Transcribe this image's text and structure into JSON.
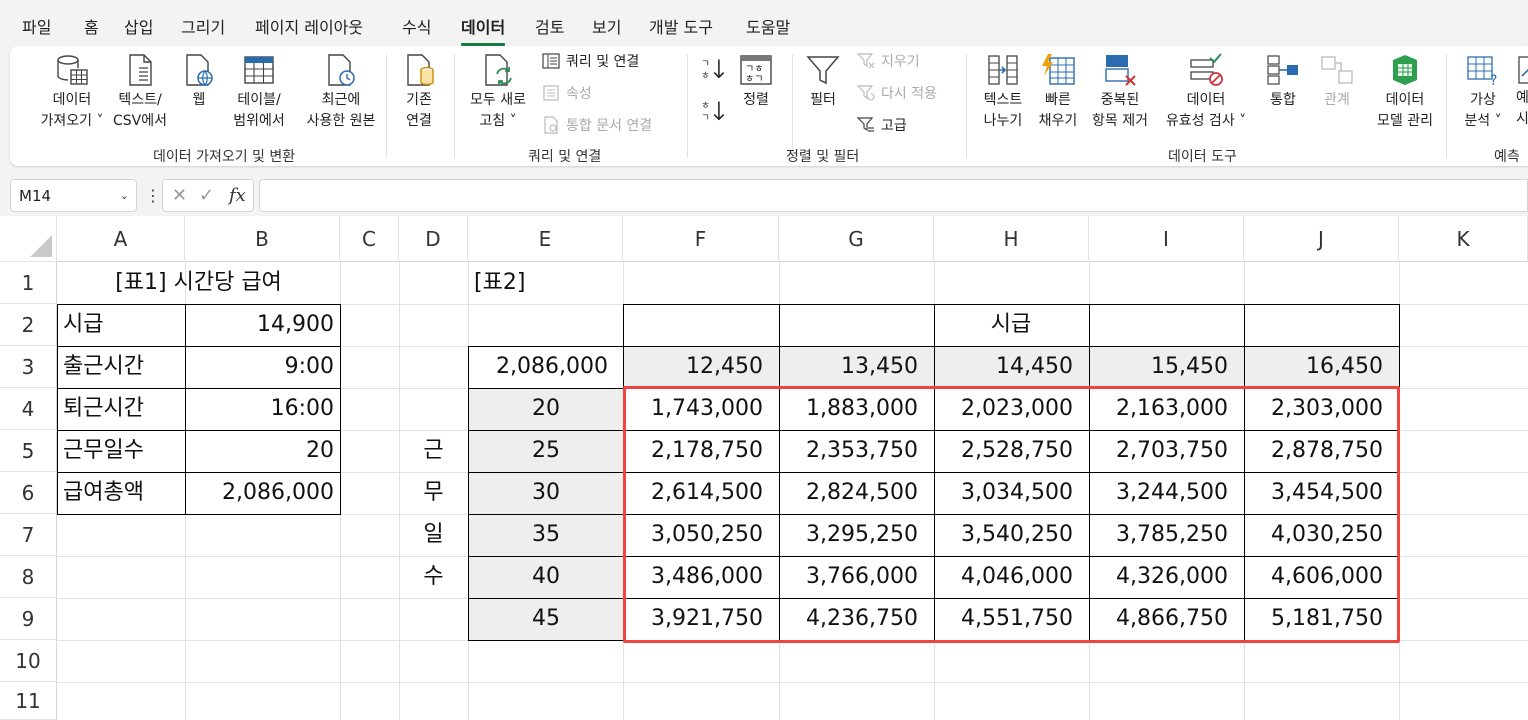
{
  "menu": [
    "파일",
    "홈",
    "삽입",
    "그리기",
    "페이지 레이아웃",
    "수식",
    "데이터",
    "검토",
    "보기",
    "개발 도구",
    "도움말"
  ],
  "active_menu": "데이터",
  "ribbon": {
    "get_data": {
      "l1": "데이터",
      "l2": "가져오기 ˅"
    },
    "text_csv": {
      "l1": "텍스트/",
      "l2": "CSV에서"
    },
    "web": {
      "l1": "웹"
    },
    "table_range": {
      "l1": "테이블/",
      "l2": "범위에서"
    },
    "recent_sources": {
      "l1": "최근에",
      "l2": "사용한 원본"
    },
    "existing_conn": {
      "l1": "기존",
      "l2": "연결"
    },
    "group1": "데이터 가져오기 및 변환",
    "refresh_all": {
      "l1": "모두 새로",
      "l2": "고침 ˅"
    },
    "queries_conn": "쿼리 및 연결",
    "properties": "속성",
    "edit_links": "통합 문서 연결",
    "group2": "쿼리 및 연결",
    "sort": "정렬",
    "filter": "필터",
    "clear": "지우기",
    "reapply": "다시 적용",
    "advanced": "고급",
    "group3": "정렬 및 필터",
    "text_to_cols": {
      "l1": "텍스트",
      "l2": "나누기"
    },
    "flash_fill": {
      "l1": "빠른",
      "l2": "채우기"
    },
    "remove_dup": {
      "l1": "중복된",
      "l2": "항목 제거"
    },
    "data_validation": {
      "l1": "데이터",
      "l2": "유효성 검사 ˅"
    },
    "consolidate": {
      "l1": "통합"
    },
    "relationships": {
      "l1": "관계"
    },
    "data_model": {
      "l1": "데이터",
      "l2": "모델 관리"
    },
    "group4": "데이터 도구",
    "what_if": {
      "l1": "가상",
      "l2": "분석 ˅"
    },
    "forecast_sheet": {
      "l1": "예",
      "l2": "시"
    },
    "group5": "예측"
  },
  "namebox": "M14",
  "fx_label": "fx",
  "columns": [
    "A",
    "B",
    "C",
    "D",
    "E",
    "F",
    "G",
    "H",
    "I",
    "J",
    "K"
  ],
  "rows": [
    "1",
    "2",
    "3",
    "4",
    "5",
    "6",
    "7",
    "8",
    "9",
    "10",
    "11"
  ],
  "table1": {
    "title": "[표1]  시간당 급여",
    "rows": [
      {
        "label": "시급",
        "value": "14,900"
      },
      {
        "label": "출근시간",
        "value": "9:00"
      },
      {
        "label": "퇴근시간",
        "value": "16:00"
      },
      {
        "label": "근무일수",
        "value": "20"
      },
      {
        "label": "급여총액",
        "value": "2,086,000"
      }
    ]
  },
  "table2": {
    "title": "[표2]",
    "header": "시급",
    "corner": "2,086,000",
    "side_label": [
      "근",
      "무",
      "일",
      "수"
    ],
    "wages": [
      "12,450",
      "13,450",
      "14,450",
      "15,450",
      "16,450"
    ],
    "days": [
      "20",
      "25",
      "30",
      "35",
      "40",
      "45"
    ],
    "values": [
      [
        "1,743,000",
        "1,883,000",
        "2,023,000",
        "2,163,000",
        "2,303,000"
      ],
      [
        "2,178,750",
        "2,353,750",
        "2,528,750",
        "2,703,750",
        "2,878,750"
      ],
      [
        "2,614,500",
        "2,824,500",
        "3,034,500",
        "3,244,500",
        "3,454,500"
      ],
      [
        "3,050,250",
        "3,295,250",
        "3,540,250",
        "3,785,250",
        "4,030,250"
      ],
      [
        "3,486,000",
        "3,766,000",
        "4,046,000",
        "4,326,000",
        "4,606,000"
      ],
      [
        "3,921,750",
        "4,236,750",
        "4,551,750",
        "4,866,750",
        "5,181,750"
      ]
    ]
  }
}
